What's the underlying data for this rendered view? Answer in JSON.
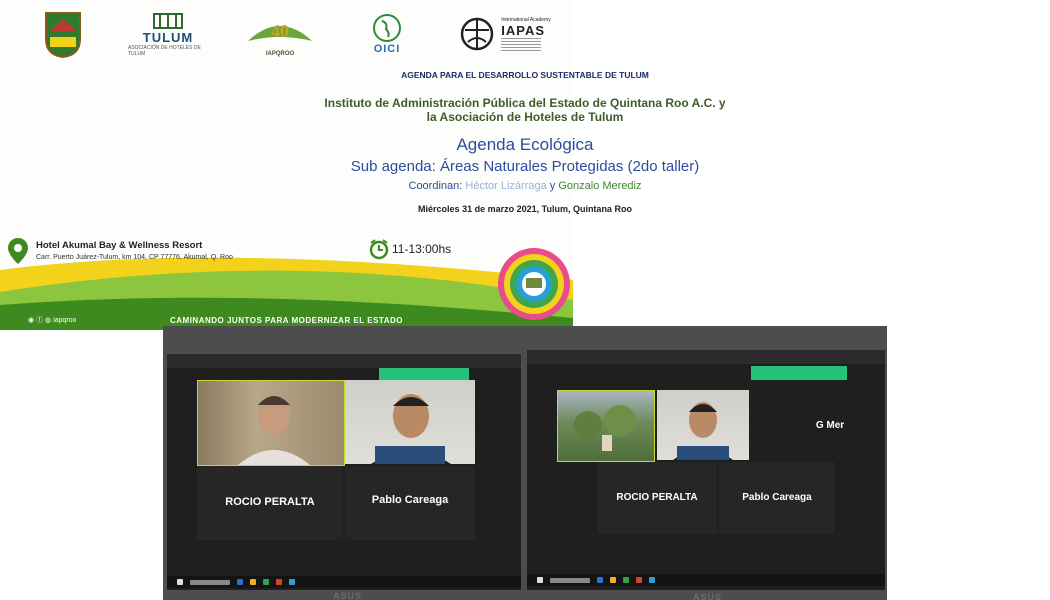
{
  "flyer": {
    "logos": {
      "tulum": "TULUM",
      "tulum_sub": "ASOCIACIÓN DE HOTELES DE TULUM",
      "iapqroo": "IAPQROO",
      "oici": "OICI",
      "iapas": "IAPAS",
      "iapas_top": "International Academy"
    },
    "agenda_dev": "AGENDA PARA EL DESARROLLO SUSTENTABLE DE TULUM",
    "institute_line1": "Instituto de Administración Pública del Estado de Quintana Roo A.C. y",
    "institute_line2": "la Asociación de Hoteles de Tulum",
    "agenda_title": "Agenda Ecológica",
    "sub_agenda": "Sub agenda: Áreas Naturales Protegidas (2do taller)",
    "coordinan_label": "Coordinan:",
    "coordinator1": "Héctor Lizárraga",
    "and": "y",
    "coordinator2": "Gonzalo Merediz",
    "date": "Miércoles 31 de marzo 2021, Tulum, Quintana Roo",
    "venue_name": "Hotel Akumal Bay & Wellness Resort",
    "venue_address": "Carr. Puerto Juárez-Tulum, km 104, CP 77776, Akumal, Q. Roo",
    "time": "11-13:00hs",
    "social_handle": "iapqroo",
    "slogan": "CAMINANDO JUNTOS PARA MODERNIZAR EL ESTADO",
    "colors": {
      "green": "#3f8a1f",
      "yellow": "#f2d21b",
      "blue": "#2a4da0"
    }
  },
  "screenshot_left": {
    "participants": [
      {
        "name": "ROCIO PERALTA"
      },
      {
        "name": "Pablo Careaga"
      }
    ]
  },
  "screenshot_right": {
    "participants": [
      {
        "name": "ROCIO PERALTA"
      },
      {
        "name": "Pablo Careaga"
      },
      {
        "name": "G Mer"
      }
    ]
  },
  "bezel_brand": "ASUS"
}
